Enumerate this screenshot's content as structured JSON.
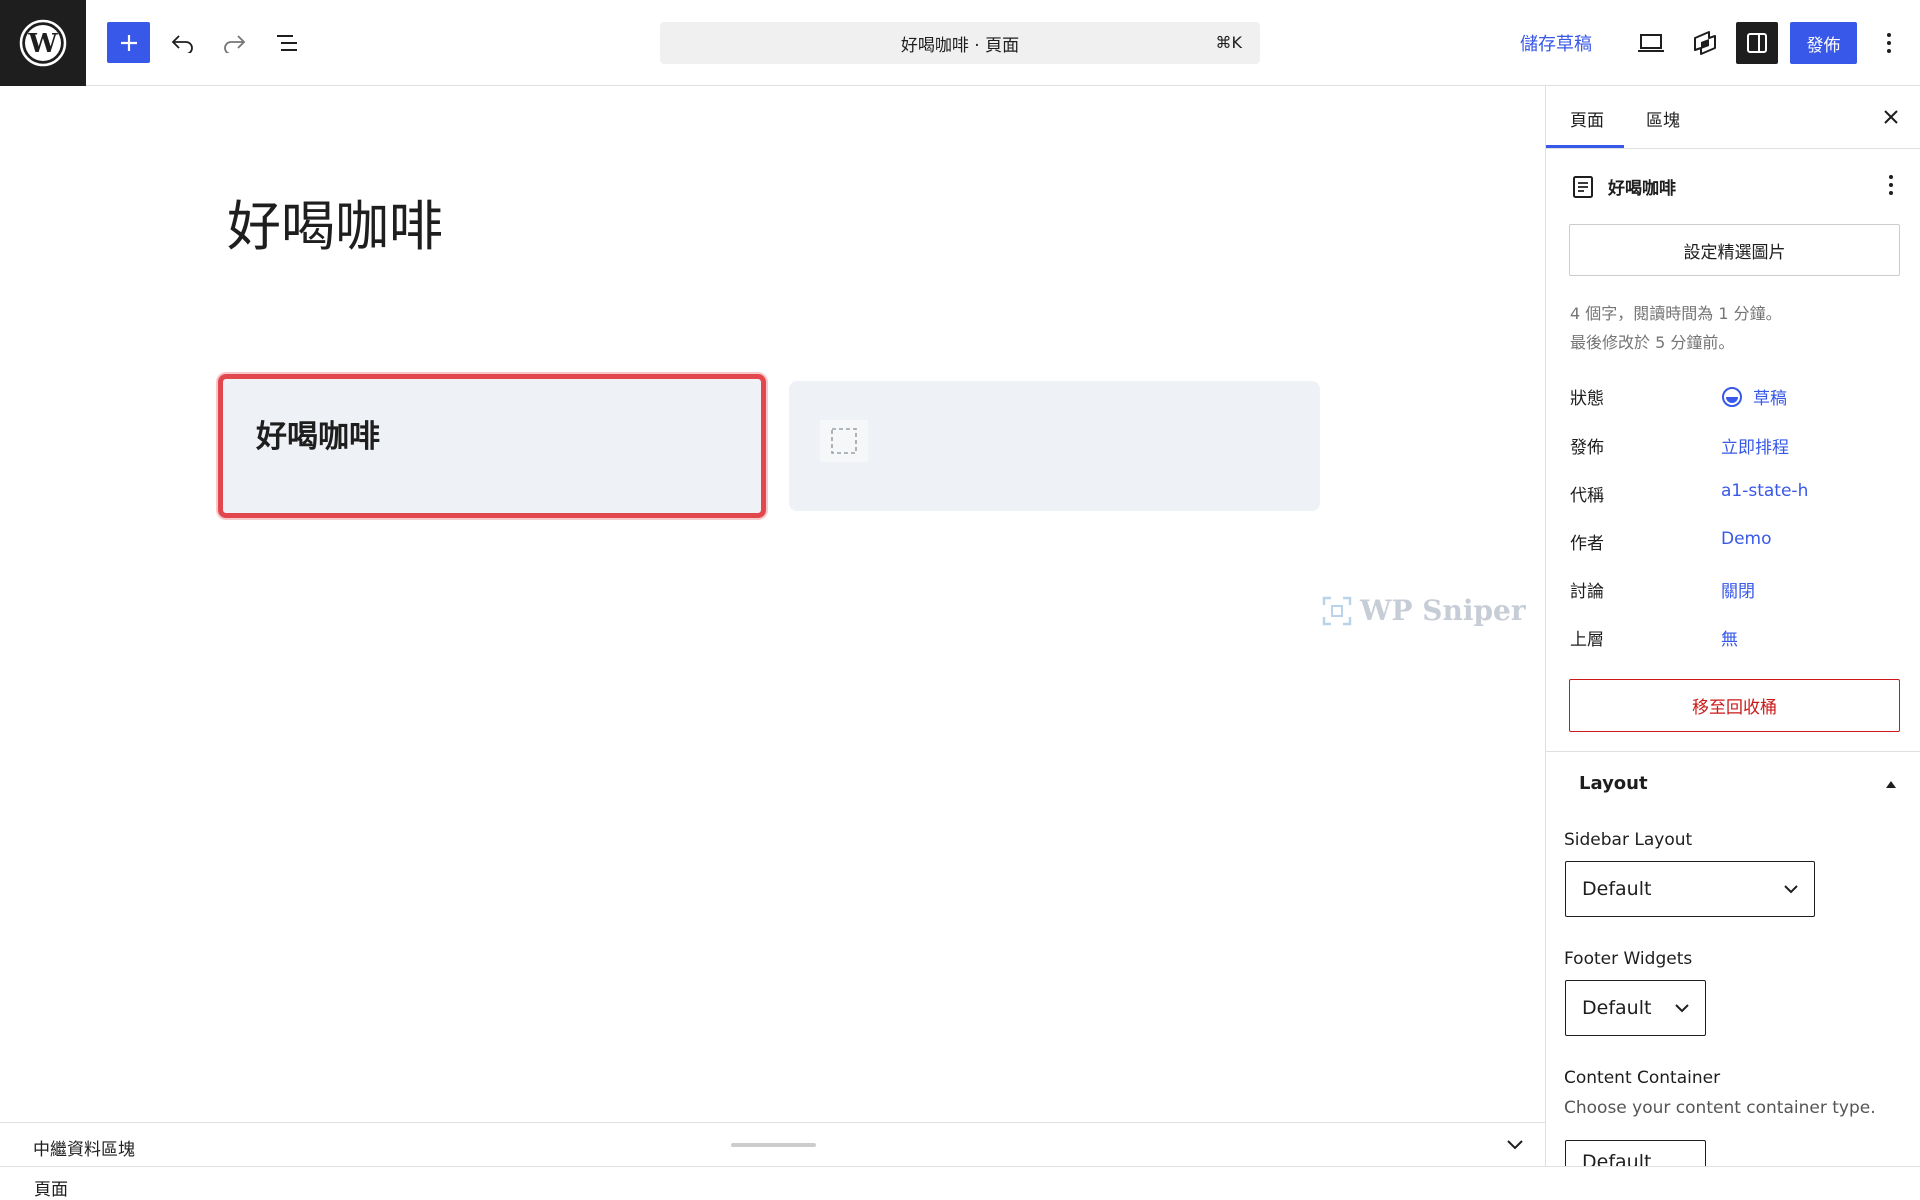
{
  "topbar": {
    "command_bar_title": "好喝咖啡 · 頁面",
    "command_bar_shortcut": "⌘K",
    "save_draft_label": "儲存草稿",
    "publish_label": "發佈"
  },
  "canvas": {
    "page_title": "好喝咖啡",
    "card_title": "好喝咖啡",
    "watermark": "WP Sniper"
  },
  "meta_bar": {
    "label": "中繼資料區塊"
  },
  "footer": {
    "breadcrumb": "頁面"
  },
  "sidebar": {
    "tabs": [
      {
        "label": "頁面"
      },
      {
        "label": "區塊"
      }
    ],
    "page_title": "好喝咖啡",
    "featured_image_label": "設定精選圖片",
    "word_count_text": "4 個字，閱讀時間為 1 分鐘。",
    "last_modified_text": "最後修改於 5 分鐘前。",
    "fields": [
      {
        "label": "狀態",
        "value": "草稿"
      },
      {
        "label": "發佈",
        "value": "立即排程"
      },
      {
        "label": "代稱",
        "value": "a1-state-h"
      },
      {
        "label": "作者",
        "value": "Demo"
      },
      {
        "label": "討論",
        "value": "關閉"
      },
      {
        "label": "上層",
        "value": "無"
      }
    ],
    "trash_label": "移至回收桶",
    "layout": {
      "title": "Layout",
      "sidebar_layout_label": "Sidebar Layout",
      "sidebar_layout_value": "Default",
      "footer_widgets_label": "Footer Widgets",
      "footer_widgets_value": "Default",
      "content_container_label": "Content Container",
      "content_container_help": "Choose your content container type.",
      "content_container_value": "Default"
    }
  },
  "colors": {
    "accent": "#3858e9",
    "danger": "#cc1818",
    "selection_outline": "#e2474e",
    "card_background": "#eef1f6"
  }
}
